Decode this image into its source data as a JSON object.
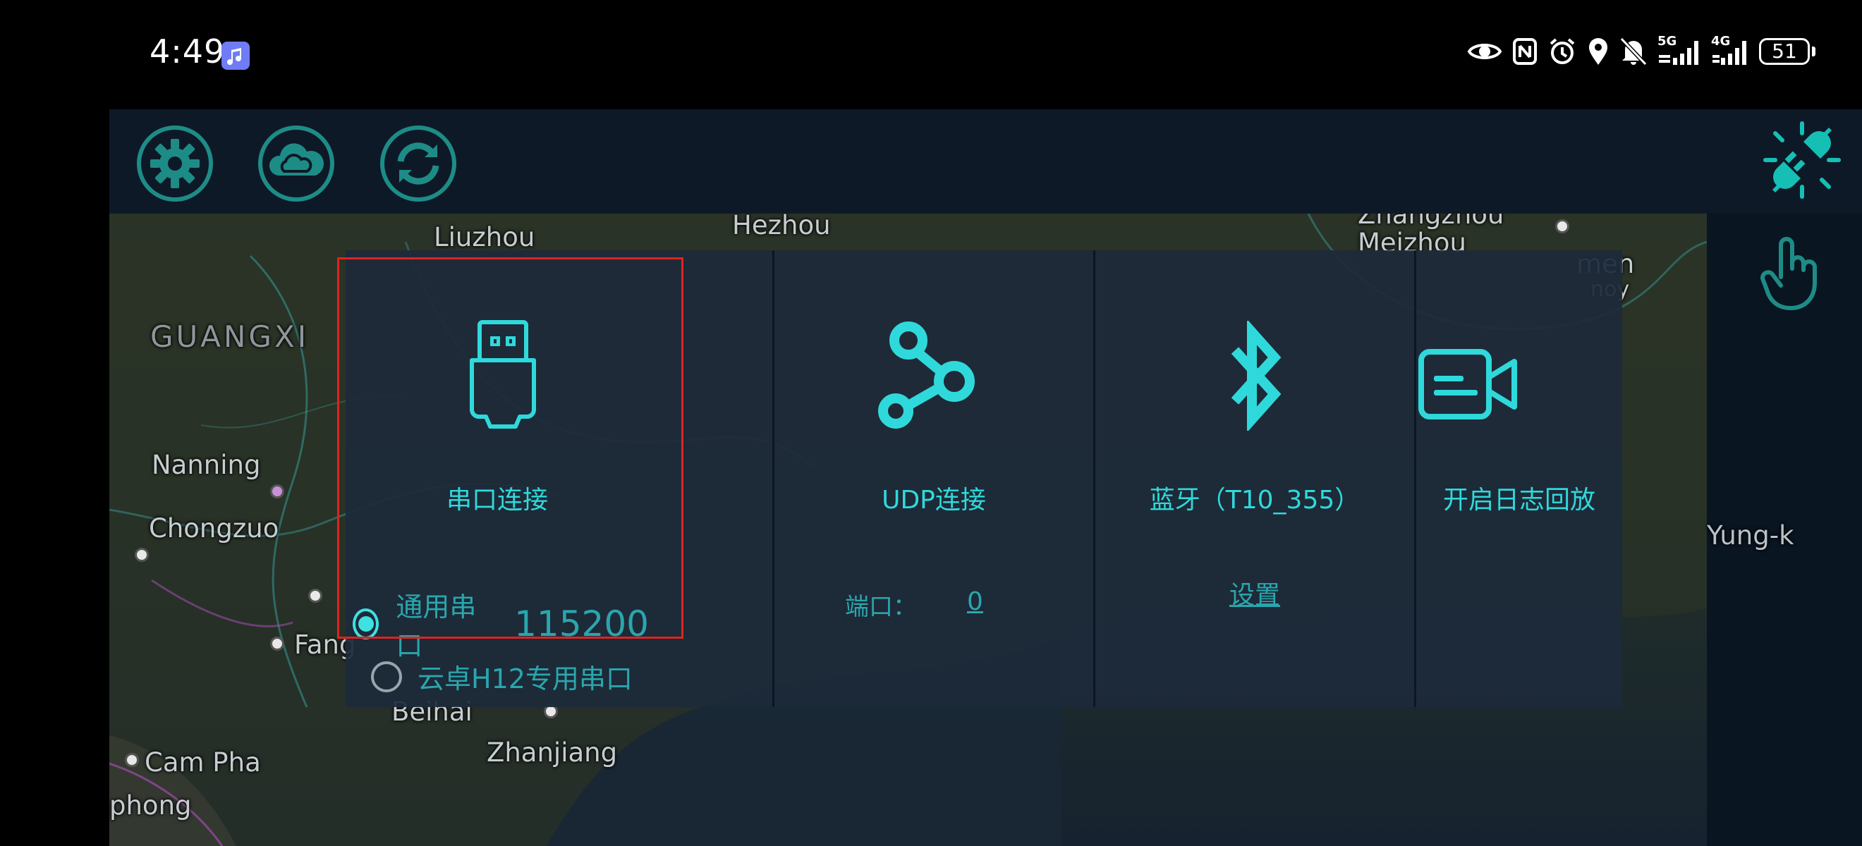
{
  "status_bar": {
    "time": "4:49",
    "network_1": "5G",
    "network_2": "4G",
    "battery_level": "51"
  },
  "toolbar": {
    "icons": [
      "gear-icon",
      "cloud-icon",
      "sync-icon",
      "disconnected-plug-icon",
      "hand-pointer-icon"
    ]
  },
  "map": {
    "labels": {
      "liuzhou": "Liuzhou",
      "hezhou": "Hezhou",
      "meizhou": "Meizhou",
      "guangxi": "GUANGXI",
      "nanning": "Nanning",
      "chongzuo": "Chongzuo",
      "fang": "Fang",
      "beihai": "Beihai",
      "zhanjiang": "Zhanjiang",
      "cam_pha": "Cam Pha",
      "phong": "phong",
      "amen": "men",
      "amoy": "noy",
      "yung_k": "Yung-k",
      "zhangzhou": "Zhangzhou"
    }
  },
  "dialog": {
    "serial": {
      "title": "串口连接",
      "option_general": "通用串口",
      "baud_rate": "115200",
      "option_h12": "云卓H12专用串口",
      "selected": "option_general"
    },
    "udp": {
      "title": "UDP连接",
      "port_label": "端口：",
      "port_value": "0"
    },
    "bluetooth": {
      "title": "蓝牙（T10_355）",
      "settings_link": "设置"
    },
    "log_playback": {
      "title": "开启日志回放"
    }
  },
  "colors": {
    "accent": "#2fd9db",
    "accent_dim": "#2aa6ad",
    "toolbar_icon": "#1e8c86",
    "warning_icon": "#16bfb4",
    "highlight_border": "#e0231f"
  }
}
